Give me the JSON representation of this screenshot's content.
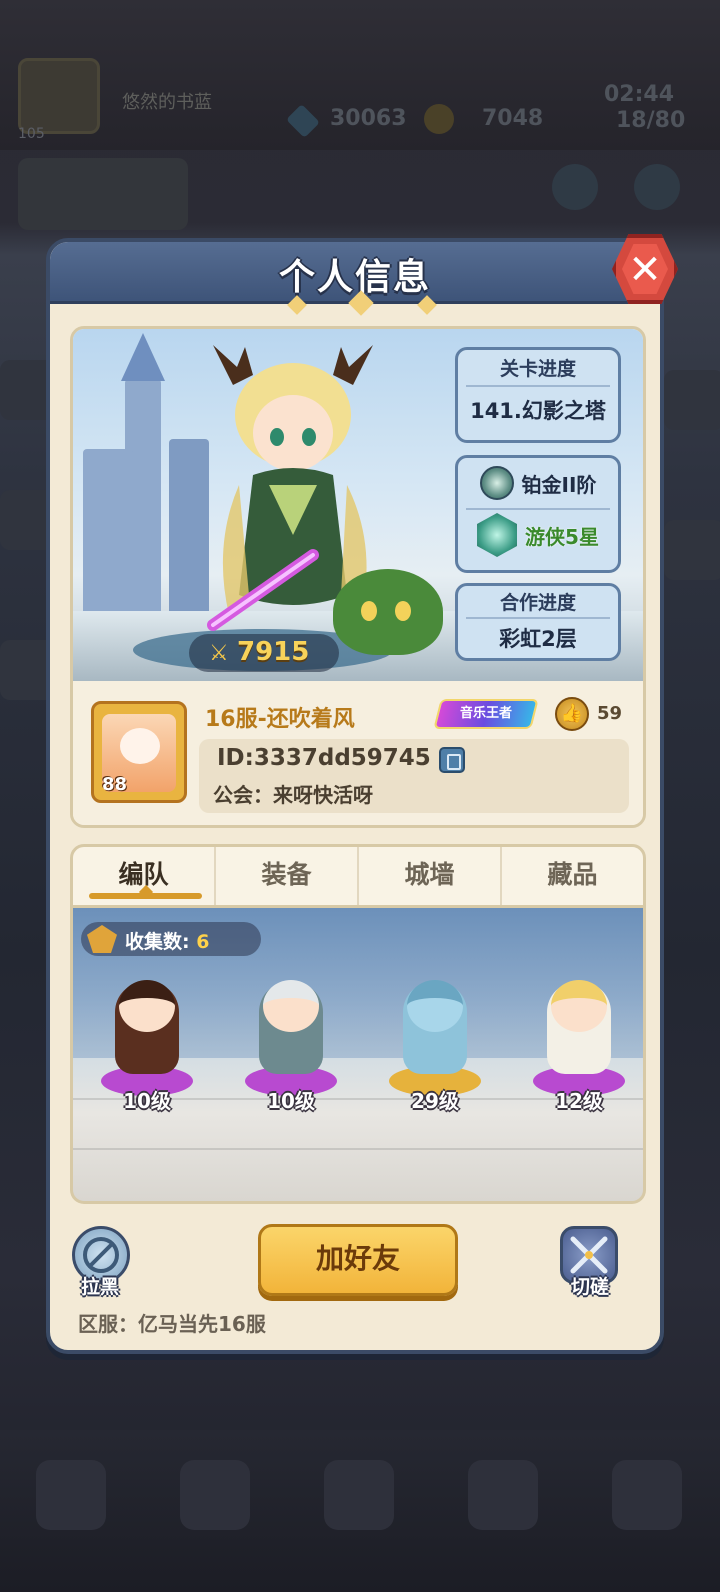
{
  "background": {
    "player_name": "悠然的书蓝",
    "player_level": "105",
    "gems": "30063",
    "coins": "7048",
    "time": "02:44",
    "stamina": "18/80"
  },
  "dialog": {
    "title": "个人信息",
    "close_icon": "close-icon"
  },
  "hero": {
    "power_icon": "sword-icon",
    "power": "7915"
  },
  "info": {
    "stage_label": "关卡进度",
    "stage_value": "141.幻影之塔",
    "rank_tier": "铂金II阶",
    "rank_class": "游侠5星",
    "coop_label": "合作进度",
    "coop_value": "彩虹2层"
  },
  "profile": {
    "avatar_level": "88",
    "name": "16服-还吹着风",
    "title_badge": "音乐王者",
    "like_icon": "thumbs-up-icon",
    "likes": "59",
    "id": "ID:3337dd59745",
    "guild": "公会：来呀快活呀"
  },
  "tabs": [
    {
      "label": "编队",
      "active": true
    },
    {
      "label": "装备",
      "active": false
    },
    {
      "label": "城墙",
      "active": false
    },
    {
      "label": "藏品",
      "active": false
    }
  ],
  "team": {
    "collect_label": "收集数:",
    "collect_count": "6",
    "heroes": [
      {
        "level": "10级",
        "color": "#8a4b2b"
      },
      {
        "level": "10级",
        "color": "#cfd6d8"
      },
      {
        "level": "29级",
        "color": "#7fb5cf"
      },
      {
        "level": "12级",
        "color": "#f1d27a"
      }
    ]
  },
  "actions": {
    "block_label": "拉黑",
    "add_friend_label": "加好友",
    "duel_label": "切磋"
  },
  "server": "区服：亿马当先16服"
}
